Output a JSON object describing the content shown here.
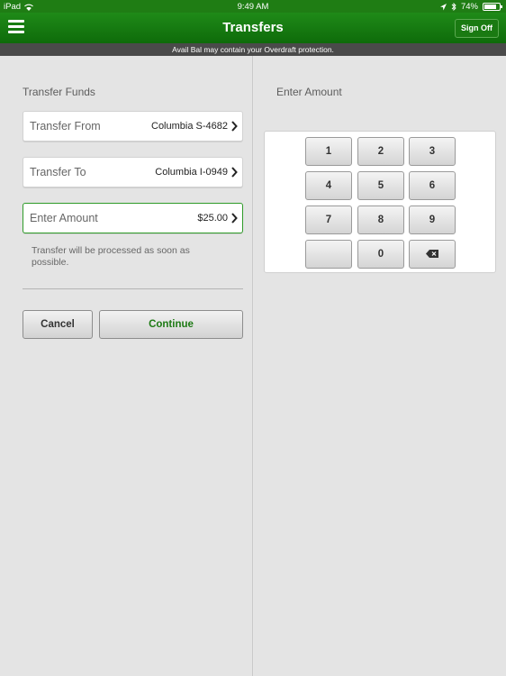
{
  "status_bar": {
    "device": "iPad",
    "time": "9:49 AM",
    "battery": "74%"
  },
  "nav": {
    "title": "Transfers",
    "sign_off_label": "Sign Off"
  },
  "info_banner": "Avail Bal may contain your Overdraft protection.",
  "transfer": {
    "title": "Transfer Funds",
    "from_label": "Transfer From",
    "from_value": "Columbia S-4682",
    "to_label": "Transfer To",
    "to_value": "Columbia I-0949",
    "amount_label": "Enter Amount",
    "amount_value": "$25.00",
    "note": "Transfer will be processed as soon as possible.",
    "cancel_label": "Cancel",
    "continue_label": "Continue"
  },
  "keypad": {
    "title": "Enter Amount",
    "keys": [
      "1",
      "2",
      "3",
      "4",
      "5",
      "6",
      "7",
      "8",
      "9",
      "",
      "0",
      "backspace"
    ]
  },
  "colors": {
    "brand_green": "#1f7d14",
    "accent_text_green": "#1d7a14"
  },
  "icons": {
    "menu": "hamburger-menu-icon",
    "chevron": "chevron-right-icon",
    "backspace": "backspace-icon",
    "wifi": "wifi-icon",
    "location": "location-arrow-icon",
    "bluetooth": "bluetooth-icon",
    "battery": "battery-icon"
  }
}
